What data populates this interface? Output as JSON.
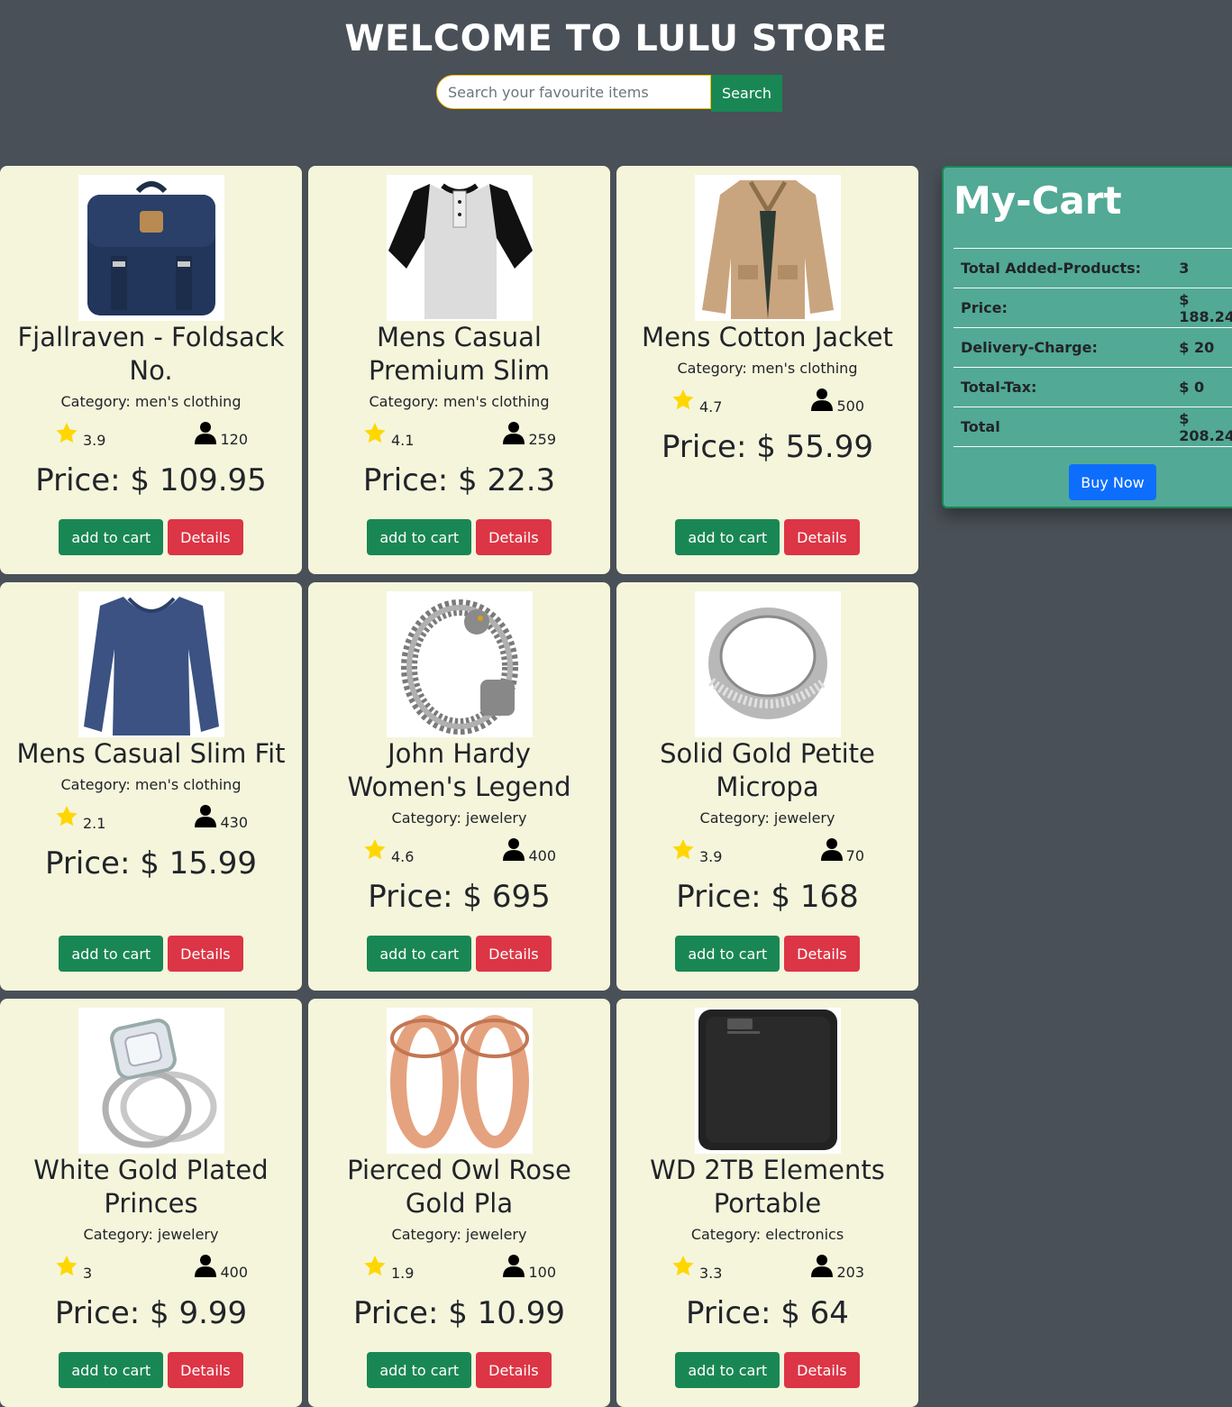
{
  "header": {
    "title": "WELCOME TO LULU STORE",
    "search_placeholder": "Search your favourite items",
    "search_button": "Search"
  },
  "products": [
    {
      "title": "Fjallraven - Foldsack No.",
      "category": "Category: men's clothing",
      "rating": "3.9",
      "count": "120",
      "price": "Price: $ 109.95",
      "add_label": "add to cart",
      "details_label": "Details",
      "image": "backpack"
    },
    {
      "title": "Mens Casual Premium Slim",
      "category": "Category: men's clothing",
      "rating": "4.1",
      "count": "259",
      "price": "Price: $ 22.3",
      "add_label": "add to cart",
      "details_label": "Details",
      "image": "tshirt"
    },
    {
      "title": "Mens Cotton Jacket",
      "category": "Category: men's clothing",
      "rating": "4.7",
      "count": "500",
      "price": "Price: $ 55.99",
      "add_label": "add to cart",
      "details_label": "Details",
      "image": "jacket"
    },
    {
      "title": "Mens Casual Slim Fit",
      "category": "Category: men's clothing",
      "rating": "2.1",
      "count": "430",
      "price": "Price: $ 15.99",
      "add_label": "add to cart",
      "details_label": "Details",
      "image": "longsleeve"
    },
    {
      "title": "John Hardy Women's Legend",
      "category": "Category: jewelery",
      "rating": "4.6",
      "count": "400",
      "price": "Price: $ 695",
      "add_label": "add to cart",
      "details_label": "Details",
      "image": "bracelet"
    },
    {
      "title": "Solid Gold Petite Micropa",
      "category": "Category: jewelery",
      "rating": "3.9",
      "count": "70",
      "price": "Price: $ 168",
      "add_label": "add to cart",
      "details_label": "Details",
      "image": "ring"
    },
    {
      "title": "White Gold Plated Princes",
      "category": "Category: jewelery",
      "rating": "3",
      "count": "400",
      "price": "Price: $ 9.99",
      "add_label": "add to cart",
      "details_label": "Details",
      "image": "diamond-ring"
    },
    {
      "title": "Pierced Owl Rose Gold Pla",
      "category": "Category: jewelery",
      "rating": "1.9",
      "count": "100",
      "price": "Price: $ 10.99",
      "add_label": "add to cart",
      "details_label": "Details",
      "image": "rose-gold-plugs"
    },
    {
      "title": "WD 2TB Elements Portable",
      "category": "Category: electronics",
      "rating": "3.3",
      "count": "203",
      "price": "Price: $ 64",
      "add_label": "add to cart",
      "details_label": "Details",
      "image": "hard-drive"
    }
  ],
  "cart": {
    "title": "My-Cart",
    "rows": [
      {
        "label": "Total Added-Products:",
        "value": "3"
      },
      {
        "label": "Price:",
        "value": "$ 188.24"
      },
      {
        "label": "Delivery-Charge:",
        "value": "$ 20"
      },
      {
        "label": "Total-Tax:",
        "value": "$ 0"
      },
      {
        "label": "Total",
        "value": "$ 208.24"
      }
    ],
    "buy_label": "Buy Now"
  },
  "colors": {
    "background": "#495057",
    "card": "#f5f5dc",
    "cart": "#52a995",
    "add_button": "#198754",
    "details_button": "#dc3545",
    "buy_button": "#0d6efd",
    "star": "#ffd700"
  },
  "icons": {
    "rating": "star-icon",
    "count": "user-icon"
  }
}
